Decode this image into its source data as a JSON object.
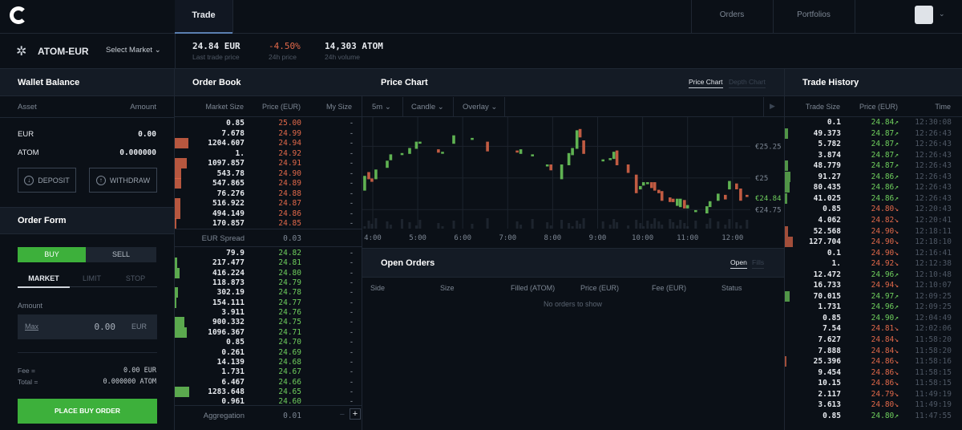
{
  "nav": {
    "tab_trade": "Trade",
    "orders": "Orders",
    "portfolios": "Portfolios"
  },
  "market": {
    "pair": "ATOM-EUR",
    "select": "Select Market",
    "last_price": "24.84 EUR",
    "last_price_label": "Last trade price",
    "change": "-4.50%",
    "change_label": "24h price",
    "volume": "14,303 ATOM",
    "volume_label": "24h volume"
  },
  "wallet": {
    "title": "Wallet Balance",
    "col_asset": "Asset",
    "col_amount": "Amount",
    "rows": [
      {
        "asset": "EUR",
        "amount": "0.00"
      },
      {
        "asset": "ATOM",
        "amount": "0.000000"
      }
    ],
    "deposit": "DEPOSIT",
    "withdraw": "WITHDRAW"
  },
  "order_form": {
    "title": "Order Form",
    "buy": "BUY",
    "sell": "SELL",
    "tabs": [
      "MARKET",
      "LIMIT",
      "STOP"
    ],
    "amount_label": "Amount",
    "max": "Max",
    "amount_value": "0.00",
    "currency": "EUR",
    "fee_label": "Fee =",
    "fee_value": "0.00 EUR",
    "total_label": "Total =",
    "total_value": "0.000000 ATOM",
    "place": "PLACE BUY ORDER"
  },
  "order_book": {
    "title": "Order Book",
    "cols": [
      "Market Size",
      "Price (EUR)",
      "My Size"
    ],
    "asks": [
      [
        "0.85",
        "25.00"
      ],
      [
        "7.678",
        "24.99"
      ],
      [
        "1204.607",
        "24.94"
      ],
      [
        "1.",
        "24.92"
      ],
      [
        "1097.857",
        "24.91"
      ],
      [
        "543.78",
        "24.90"
      ],
      [
        "547.865",
        "24.89"
      ],
      [
        "76.276",
        "24.88"
      ],
      [
        "516.922",
        "24.87"
      ],
      [
        "494.149",
        "24.86"
      ],
      [
        "170.857",
        "24.85"
      ]
    ],
    "spread_label": "EUR Spread",
    "spread": "0.03",
    "bids": [
      [
        "79.9",
        "24.82"
      ],
      [
        "217.477",
        "24.81"
      ],
      [
        "416.224",
        "24.80"
      ],
      [
        "118.873",
        "24.79"
      ],
      [
        "302.19",
        "24.78"
      ],
      [
        "154.111",
        "24.77"
      ],
      [
        "3.911",
        "24.76"
      ],
      [
        "900.332",
        "24.75"
      ],
      [
        "1096.367",
        "24.71"
      ],
      [
        "0.85",
        "24.70"
      ],
      [
        "0.261",
        "24.69"
      ],
      [
        "14.139",
        "24.68"
      ],
      [
        "1.731",
        "24.67"
      ],
      [
        "6.467",
        "24.66"
      ],
      [
        "1283.648",
        "24.65"
      ],
      [
        "0.961",
        "24.60"
      ]
    ],
    "my_size": "-",
    "aggregation_label": "Aggregation",
    "aggregation": "0.01",
    "minus": "−",
    "plus": "+"
  },
  "price_chart": {
    "title": "Price Chart",
    "tab_price": "Price Chart",
    "tab_depth": "Depth Chart",
    "interval": "5m",
    "type": "Candle",
    "overlay": "Overlay"
  },
  "chart_data": {
    "type": "candlestick",
    "x_ticks": [
      "4:00",
      "5:00",
      "6:00",
      "7:00",
      "8:00",
      "9:00",
      "10:00",
      "11:00",
      "12:00"
    ],
    "y_ticks": [
      "€25.25",
      "€25",
      "€24.75"
    ],
    "y_tick_values": [
      25.25,
      25,
      24.75
    ],
    "last_label": "€24.84",
    "last": 24.84,
    "ylim": [
      24.6,
      25.48
    ],
    "xlim": [
      3.78,
      12.45
    ],
    "candles": [
      [
        3.82,
        24.9,
        25.01
      ],
      [
        3.91,
        25.04,
        24.99
      ],
      [
        3.98,
        24.99,
        24.97
      ],
      [
        4.07,
        24.99,
        25.06
      ],
      [
        4.32,
        25.08,
        25.13
      ],
      [
        4.4,
        25.14,
        25.18
      ],
      [
        4.65,
        25.19,
        25.19
      ],
      [
        4.82,
        25.19,
        25.23
      ],
      [
        4.97,
        25.23,
        25.28
      ],
      [
        5.05,
        25.28,
        25.28
      ],
      [
        5.46,
        25.22,
        25.2
      ],
      [
        5.55,
        25.2,
        25.2
      ],
      [
        5.8,
        25.27,
        25.33
      ],
      [
        6.21,
        25.31,
        25.31
      ],
      [
        6.55,
        25.28,
        25.21
      ],
      [
        7.21,
        25.21,
        25.2
      ],
      [
        7.29,
        25.19,
        25.22
      ],
      [
        7.55,
        25.18,
        25.18
      ],
      [
        7.88,
        25.1,
        25.1
      ],
      [
        7.96,
        25.1,
        25.06
      ],
      [
        8.2,
        24.99,
        25.1
      ],
      [
        8.36,
        25.1,
        25.19
      ],
      [
        8.44,
        25.18,
        25.23
      ],
      [
        8.54,
        25.23,
        25.37
      ],
      [
        8.61,
        25.38,
        25.32
      ],
      [
        8.69,
        25.29,
        25.19
      ],
      [
        9.12,
        25.14,
        25.14
      ],
      [
        9.28,
        25.15,
        25.15
      ],
      [
        9.36,
        25.15,
        25.2
      ],
      [
        9.43,
        25.21,
        25.1
      ],
      [
        9.68,
        25.1,
        25.04
      ],
      [
        9.86,
        25.02,
        24.88
      ],
      [
        9.95,
        24.91,
        24.93
      ],
      [
        10.02,
        24.94,
        24.96
      ],
      [
        10.11,
        24.96,
        24.96
      ],
      [
        10.2,
        24.96,
        24.92
      ],
      [
        10.27,
        24.96,
        24.9
      ],
      [
        10.36,
        24.9,
        24.88
      ],
      [
        10.43,
        24.89,
        24.82
      ],
      [
        10.61,
        24.84,
        24.81
      ],
      [
        10.68,
        24.83,
        24.81
      ],
      [
        10.77,
        24.78,
        24.83
      ],
      [
        10.84,
        24.77,
        24.83
      ],
      [
        10.93,
        24.82,
        24.76
      ],
      [
        11.0,
        24.76,
        24.78
      ],
      [
        11.18,
        24.74,
        24.74
      ],
      [
        11.43,
        24.72,
        24.77
      ],
      [
        11.5,
        24.77,
        24.81
      ],
      [
        11.68,
        24.82,
        24.87
      ],
      [
        11.84,
        24.86,
        24.83
      ],
      [
        11.93,
        24.91,
        24.97
      ],
      [
        12.09,
        24.95,
        24.91
      ],
      [
        12.18,
        24.91,
        24.82
      ],
      [
        12.32,
        24.86,
        24.85
      ]
    ]
  },
  "open_orders": {
    "title": "Open Orders",
    "tab_open": "Open",
    "tab_fills": "Fills",
    "cols": [
      "Side",
      "Size",
      "Filled (ATOM)",
      "Price (EUR)",
      "Fee (EUR)",
      "Status"
    ],
    "empty": "No orders to show"
  },
  "trade_history": {
    "title": "Trade History",
    "cols": [
      "Trade Size",
      "Price (EUR)",
      "Time"
    ],
    "rows": [
      [
        "0.1",
        "24.84",
        "up",
        "12:30:08"
      ],
      [
        "49.373",
        "24.87",
        "up",
        "12:26:43"
      ],
      [
        "5.782",
        "24.87",
        "up",
        "12:26:43"
      ],
      [
        "3.874",
        "24.87",
        "up",
        "12:26:43"
      ],
      [
        "48.779",
        "24.87",
        "up",
        "12:26:43"
      ],
      [
        "91.27",
        "24.86",
        "up",
        "12:26:43"
      ],
      [
        "80.435",
        "24.86",
        "up",
        "12:26:43"
      ],
      [
        "41.025",
        "24.86",
        "up",
        "12:26:43"
      ],
      [
        "0.85",
        "24.80",
        "down",
        "12:20:43"
      ],
      [
        "4.062",
        "24.82",
        "down",
        "12:20:41"
      ],
      [
        "52.568",
        "24.90",
        "down",
        "12:18:11"
      ],
      [
        "127.704",
        "24.90",
        "down",
        "12:18:10"
      ],
      [
        "0.1",
        "24.90",
        "down",
        "12:16:41"
      ],
      [
        "1.",
        "24.92",
        "down",
        "12:12:38"
      ],
      [
        "12.472",
        "24.96",
        "up",
        "12:10:48"
      ],
      [
        "16.733",
        "24.94",
        "down",
        "12:10:07"
      ],
      [
        "70.015",
        "24.97",
        "up",
        "12:09:25"
      ],
      [
        "1.731",
        "24.96",
        "up",
        "12:09:25"
      ],
      [
        "0.85",
        "24.90",
        "up",
        "12:04:49"
      ],
      [
        "7.54",
        "24.81",
        "down",
        "12:02:06"
      ],
      [
        "7.627",
        "24.84",
        "down",
        "11:58:20"
      ],
      [
        "7.888",
        "24.84",
        "down",
        "11:58:20"
      ],
      [
        "25.396",
        "24.86",
        "down",
        "11:58:16"
      ],
      [
        "9.454",
        "24.86",
        "down",
        "11:58:15"
      ],
      [
        "10.15",
        "24.86",
        "down",
        "11:58:15"
      ],
      [
        "2.117",
        "24.79",
        "down",
        "11:49:19"
      ],
      [
        "3.613",
        "24.80",
        "down",
        "11:49:19"
      ],
      [
        "0.85",
        "24.80",
        "up",
        "11:47:55"
      ]
    ],
    "arrow_up": "↗",
    "arrow_down": "↘"
  },
  "colors": {
    "green": "#6fcf5d",
    "red": "#e2694a",
    "buy": "#3db03b",
    "bg": "#0b1017"
  }
}
